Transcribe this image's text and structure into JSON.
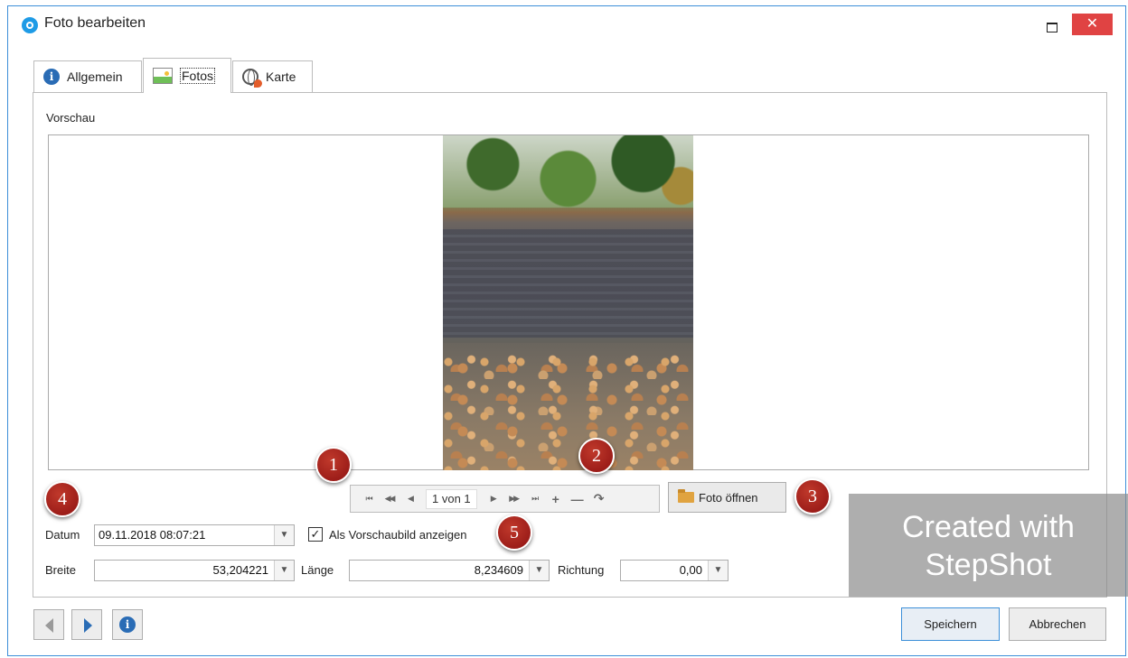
{
  "window": {
    "title": "Foto bearbeiten",
    "close_glyph": "✕"
  },
  "tabs": [
    {
      "label": "Allgemein",
      "icon": "info-icon"
    },
    {
      "label": "Fotos",
      "icon": "photo-icon",
      "active": true
    },
    {
      "label": "Karte",
      "icon": "globe-icon"
    }
  ],
  "preview": {
    "label": "Vorschau"
  },
  "navigator": {
    "first": "⏮",
    "prev_page": "◀◀",
    "prev": "◀",
    "position": "1 von 1",
    "next": "▶",
    "next_page": "▶▶",
    "last": "⏭",
    "add": "+",
    "remove": "—",
    "rotate": "↷"
  },
  "open_photo_button": "Foto öffnen",
  "form": {
    "date_label": "Datum",
    "date_value": "09.11.2018 08:07:21",
    "preview_checkbox_label": "Als Vorschaubild anzeigen",
    "preview_checkbox_checked": true,
    "latitude_label": "Breite",
    "latitude_value": "53,204221",
    "longitude_label": "Länge",
    "longitude_value": "8,234609",
    "direction_label": "Richtung",
    "direction_value": "0,00"
  },
  "watermark": {
    "line1": "Created with",
    "line2": "StepShot"
  },
  "steps": [
    "1",
    "2",
    "3",
    "4",
    "5"
  ],
  "buttons": {
    "save": "Speichern",
    "cancel": "Abbrechen"
  },
  "colors": {
    "accent": "#3c8fd8",
    "close": "#e04343",
    "step_marker": "#a01818",
    "info_blue": "#2a6cb5"
  }
}
